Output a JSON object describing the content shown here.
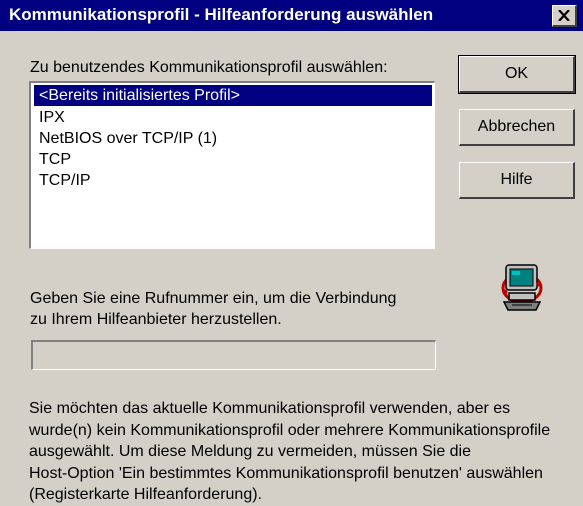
{
  "window": {
    "title": "Kommunikationsprofil - Hilfeanforderung auswählen",
    "close_icon": "close-icon"
  },
  "profile": {
    "label": "Zu benutzendes Kommunikationsprofil auswählen:",
    "items": [
      "<Bereits initialisiertes Profil>",
      "IPX",
      "NetBIOS over TCP/IP (1)",
      "TCP",
      "TCP/IP"
    ],
    "selected_index": 0
  },
  "buttons": {
    "ok": "OK",
    "cancel": "Abbrechen",
    "help": "Hilfe"
  },
  "phone": {
    "label_line1": "Geben Sie eine Rufnummer ein, um die Verbindung",
    "label_line2": "zu Ihrem Hilfeanbieter herzustellen.",
    "value": ""
  },
  "icon": "computer-network-icon",
  "info": {
    "line1": "Sie möchten das aktuelle Kommunikationsprofil verwenden, aber es",
    "line2": "wurde(n) kein Kommunikationsprofil oder mehrere Kommunikationsprofile",
    "line3": "ausgewählt. Um diese Meldung zu vermeiden, müssen Sie die",
    "line4": "Host-Option 'Ein bestimmtes Kommunikationsprofil benutzen' auswählen",
    "line5": "(Registerkarte Hilfeanforderung)."
  },
  "colors": {
    "titlebar": "#000080",
    "face": "#d4d0c8",
    "selection": "#000080"
  }
}
